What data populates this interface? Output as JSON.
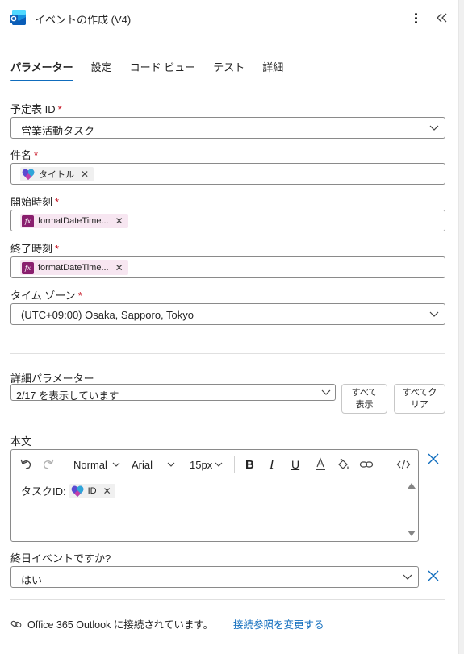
{
  "header": {
    "title": "イベントの作成 (V4)",
    "app_icon": "outlook-icon",
    "more_icon": "more-vertical-icon",
    "collapse_icon": "double-chevron-left-icon"
  },
  "tabs": [
    {
      "label": "パラメーター",
      "active": true
    },
    {
      "label": "設定",
      "active": false
    },
    {
      "label": "コード ビュー",
      "active": false
    },
    {
      "label": "テスト",
      "active": false
    },
    {
      "label": "詳細",
      "active": false
    }
  ],
  "fields": {
    "calendar": {
      "label": "予定表 ID",
      "required": "*",
      "value": "営業活動タスク"
    },
    "subject": {
      "label": "件名",
      "required": "*",
      "token": "タイトル"
    },
    "start": {
      "label": "開始時刻",
      "required": "*",
      "token": "formatDateTime...",
      "token_icon": "fx"
    },
    "end": {
      "label": "終了時刻",
      "required": "*",
      "token": "formatDateTime...",
      "token_icon": "fx"
    },
    "timezone": {
      "label": "タイム ゾーン",
      "required": "*",
      "value": "(UTC+09:00) Osaka, Sapporo, Tokyo"
    }
  },
  "advanced": {
    "label": "詳細パラメーター",
    "value": "2/17 を表示しています",
    "show_all_line1": "すべて",
    "show_all_line2": "表示",
    "clear_all_line1": "すべてク",
    "clear_all_line2": "リア"
  },
  "body": {
    "label": "本文",
    "font_style": "Normal",
    "font_family": "Arial",
    "font_size": "15px",
    "content_prefix": "タスクID:",
    "token": "ID"
  },
  "allday": {
    "label": "終日イベントですか?",
    "value": "はい"
  },
  "footer": {
    "connection_text": "Office 365 Outlook に接続されています。",
    "change_link": "接続参照を変更する"
  },
  "colors": {
    "accent": "#0f6cbd",
    "required": "#c50f1f",
    "fx_badge": "#8a1f6e",
    "fx_token_bg": "#f7e6f1"
  }
}
